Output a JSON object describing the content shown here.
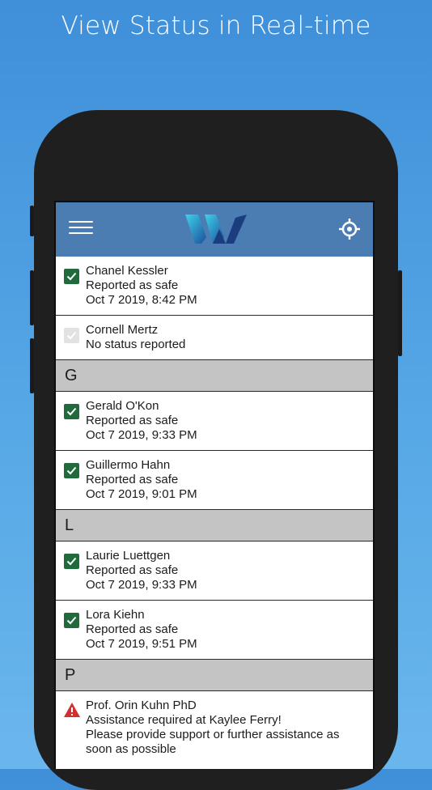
{
  "headline": "View Status in Real-time",
  "colors": {
    "background": "#4a9ce0",
    "app_bar": "#4b7db2",
    "safe_check": "#216a3b",
    "no_status_check": "#e2e2e2",
    "section_header": "#c4c4c4",
    "alert": "#d32f2f"
  },
  "app_bar": {
    "menu_icon": "hamburger-menu-icon",
    "logo_icon": "w-logo-icon",
    "locate_icon": "crosshair-locate-icon"
  },
  "top_rows": [
    {
      "name": "Chanel Kessler",
      "status": "Reported as safe",
      "time": "Oct 7 2019, 8:42 PM",
      "state": "safe"
    },
    {
      "name": "Cornell Mertz",
      "status": "No status reported",
      "state": "none"
    }
  ],
  "sections": [
    {
      "letter": "G",
      "rows": [
        {
          "name": "Gerald O'Kon",
          "status": "Reported as safe",
          "time": "Oct 7 2019, 9:33 PM",
          "state": "safe"
        },
        {
          "name": "Guillermo Hahn",
          "status": "Reported as safe",
          "time": "Oct 7 2019, 9:01 PM",
          "state": "safe"
        }
      ]
    },
    {
      "letter": "L",
      "rows": [
        {
          "name": "Laurie Luettgen",
          "status": "Reported as safe",
          "time": "Oct 7 2019, 9:33 PM",
          "state": "safe"
        },
        {
          "name": "Lora Kiehn",
          "status": "Reported as safe",
          "time": "Oct 7 2019, 9:51 PM",
          "state": "safe"
        }
      ]
    },
    {
      "letter": "P",
      "rows": [
        {
          "name": "Prof. Orin Kuhn PhD",
          "status": "Assistance required at Kaylee Ferry!",
          "line3": "Please provide support or further assistance as",
          "line4": "soon as possible",
          "state": "alert"
        }
      ]
    }
  ]
}
